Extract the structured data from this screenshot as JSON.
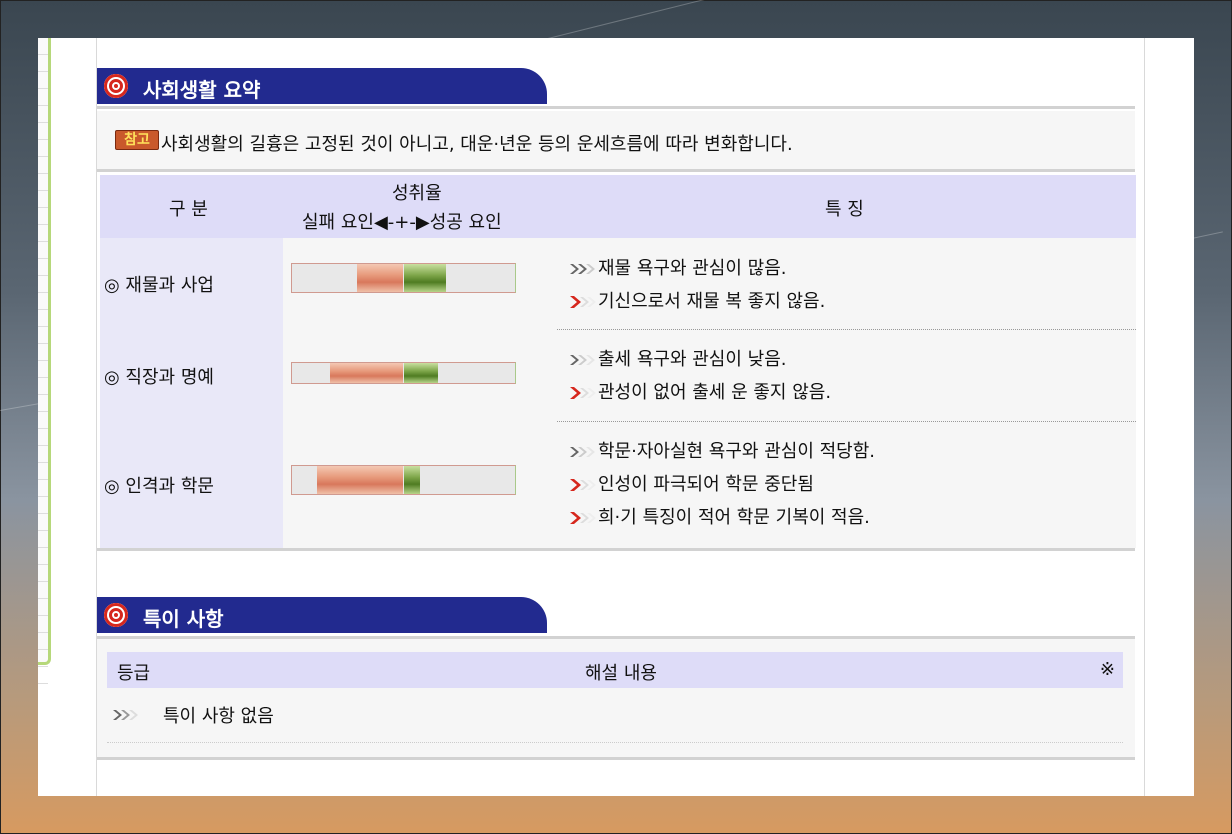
{
  "summary": {
    "title": "사회생활 요약",
    "note_tag": "참고",
    "note_text": "사회생활의 길흉은 고정된 것이 아니고, 대운·년운 등의 운세흐름에 따라 변화합니다.",
    "col_category": "구 분",
    "col_rate_title": "성취율",
    "col_rate_scale": "실패 요인◀-+-▶성공 요인",
    "col_feature": "특 징",
    "rows": [
      {
        "category": "◎ 재물과 사업",
        "failure_pct": 42,
        "success_pct": 38,
        "features": [
          {
            "icon": "gray-double-chevron-icon",
            "text": "재물 욕구와 관심이 많음."
          },
          {
            "icon": "red-chevron-icon",
            "text": "기신으로서 재물 복 좋지 않음."
          }
        ]
      },
      {
        "category": "◎ 직장과 명예",
        "failure_pct": 66,
        "success_pct": 31,
        "features": [
          {
            "icon": "gray-chevron-icon",
            "text": "출세 욕구와 관심이 낮음."
          },
          {
            "icon": "red-chevron-icon",
            "text": "관성이 없어 출세 운 좋지 않음."
          }
        ]
      },
      {
        "category": "◎ 인격과 학문",
        "failure_pct": 78,
        "success_pct": 15,
        "features": [
          {
            "icon": "gray-chevron-icon",
            "text": "학문·자아실현 욕구와 관심이 적당함."
          },
          {
            "icon": "red-chevron-icon",
            "text": "인성이 파극되어 학문 중단됨"
          },
          {
            "icon": "red-chevron-icon",
            "text": "희·기 특징이 적어 학문 기복이 적음."
          }
        ]
      }
    ]
  },
  "special": {
    "title": "특이 사항",
    "col_grade": "등급",
    "col_desc": "해설 내용",
    "col_mark": "※",
    "items": [
      {
        "icon": "gray-double-chevron-icon",
        "text": "특이 사항 없음"
      }
    ]
  },
  "colors": {
    "header_navy": "#222a8f",
    "table_header_lavender": "#dedcf8",
    "failure_salmon": "#d8785c",
    "success_green": "#4f7c22",
    "chevron_red": "#d6271d",
    "sidebar_green": "#b6d87a"
  }
}
